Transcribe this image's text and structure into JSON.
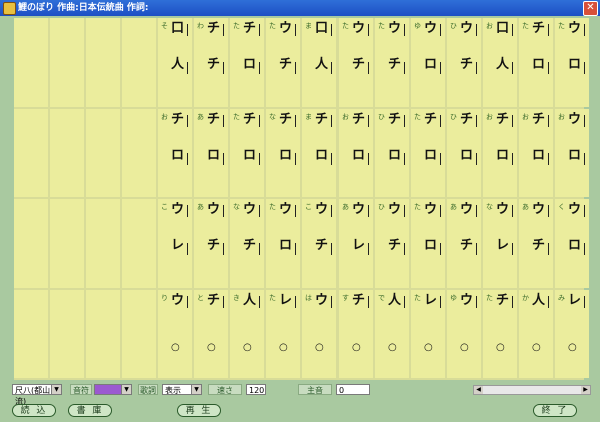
{
  "window": {
    "title": "鯉のぼり 作曲:日本伝統曲 作詞:",
    "close_icon": "close-icon"
  },
  "colors": {
    "sheet": "#ebed9d",
    "background": "#a9c9a0",
    "title_bar": "#1d4fc4",
    "accent": "#9b59d0"
  },
  "score": {
    "row1": {
      "big": [
        "口",
        "チ",
        "チ",
        "ウ",
        "口",
        "ウ",
        "ウ",
        "ウ",
        "ウ",
        "口",
        "チ",
        "ウ"
      ],
      "big2": [
        "人",
        "チ",
        "ロ",
        "チ",
        "人",
        "チ",
        "チ",
        "ロ",
        "チ",
        "人",
        "ロ",
        "ロ"
      ],
      "kana": [
        "そ",
        "わ",
        "た",
        "た",
        "ま",
        "た",
        "た",
        "ゆ",
        "ひ",
        "お",
        "た",
        "た"
      ]
    },
    "row2": {
      "big": [
        "チ",
        "チ",
        "チ",
        "チ",
        "チ",
        "チ",
        "チ",
        "チ",
        "チ",
        "チ",
        "チ",
        "ウ"
      ],
      "big2": [
        "ロ",
        "ロ",
        "ロ",
        "ロ",
        "ロ",
        "ロ",
        "ロ",
        "ロ",
        "ロ",
        "ロ",
        "ロ",
        "ロ"
      ],
      "kana": [
        "お",
        "あ",
        "た",
        "な",
        "ま",
        "お",
        "ひ",
        "た",
        "ひ",
        "お",
        "お",
        "お"
      ]
    },
    "row3": {
      "big": [
        "ウ",
        "ウ",
        "ウ",
        "ウ",
        "ウ",
        "ウ",
        "ウ",
        "ウ",
        "ウ",
        "ウ",
        "ウ",
        "ウ"
      ],
      "big2": [
        "レ",
        "チ",
        "チ",
        "ロ",
        "チ",
        "レ",
        "チ",
        "ロ",
        "チ",
        "レ",
        "チ",
        "ロ"
      ],
      "kana": [
        "こ",
        "あ",
        "な",
        "た",
        "こ",
        "あ",
        "ひ",
        "た",
        "あ",
        "な",
        "あ",
        "く"
      ]
    },
    "row4": {
      "big": [
        "ウ",
        "チ",
        "人",
        "レ",
        "ウ",
        "チ",
        "人",
        "レ",
        "ウ",
        "チ",
        "人",
        "レ"
      ],
      "kana": [
        "り",
        "と",
        "き",
        "た",
        "は",
        "す",
        "で",
        "た",
        "ゆ",
        "た",
        "か",
        "み"
      ],
      "ring": "○"
    }
  },
  "toolbar": {
    "instrument": "尺八(都山流)",
    "row_label": "音符",
    "row_value": "",
    "lyrics_label": "歌詞",
    "lyrics_value": "表示",
    "speed_label": "速さ",
    "speed_value": "120",
    "master_label": "主音",
    "master_value": "0",
    "load_button": "読 込",
    "library_button": "書 庫",
    "play_button": "再 生",
    "exit_button": "終 了"
  },
  "scrollbar": {
    "left_icon": "arrow-left-icon",
    "right_icon": "arrow-right-icon"
  }
}
